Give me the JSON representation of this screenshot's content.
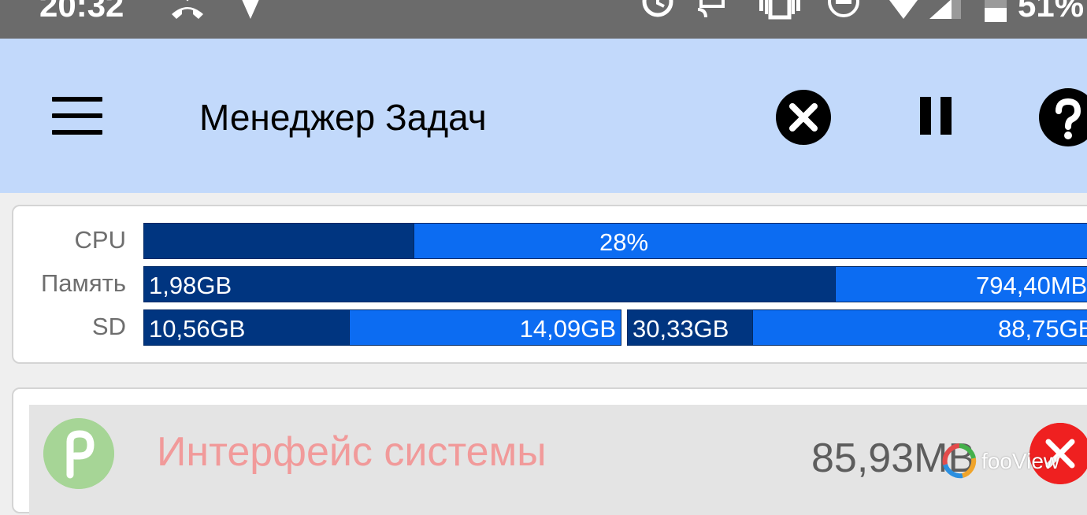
{
  "status_bar": {
    "time": "20:32",
    "battery_text": "51%",
    "icons": [
      "missed-call-icon",
      "location-icon",
      "alarm-icon",
      "cast-icon",
      "vibrate-icon",
      "do-not-disturb-icon",
      "wifi-icon",
      "signal-icon",
      "battery-icon"
    ]
  },
  "app_bar": {
    "title": "Менеджер Задач",
    "actions": [
      "kill-all-icon",
      "pause-icon",
      "help-icon"
    ]
  },
  "stats": {
    "cpu": {
      "label": "CPU",
      "value_text": "28%",
      "fraction": 0.28
    },
    "memory": {
      "label": "Память",
      "used": "1,98GB",
      "free": "794,40MB",
      "used_fraction": 0.735
    },
    "sd": {
      "label": "SD",
      "internal": {
        "used": "10,56GB",
        "free": "14,09GB",
        "used_fraction": 0.43
      },
      "external": {
        "used": "30,33GB",
        "free": "88,75GB",
        "used_fraction": 0.26
      }
    }
  },
  "processes": [
    {
      "name": "Интерфейс системы",
      "memory": "85,93MB",
      "icon": "android-p-icon"
    }
  ],
  "watermark": {
    "text": "fooView"
  },
  "colors": {
    "app_bar": "#c2d9fb",
    "bar_used": "#003580",
    "bar_free": "#0c6cf2",
    "process_name": "#f19a9a",
    "kill_button": "#ef2020"
  }
}
